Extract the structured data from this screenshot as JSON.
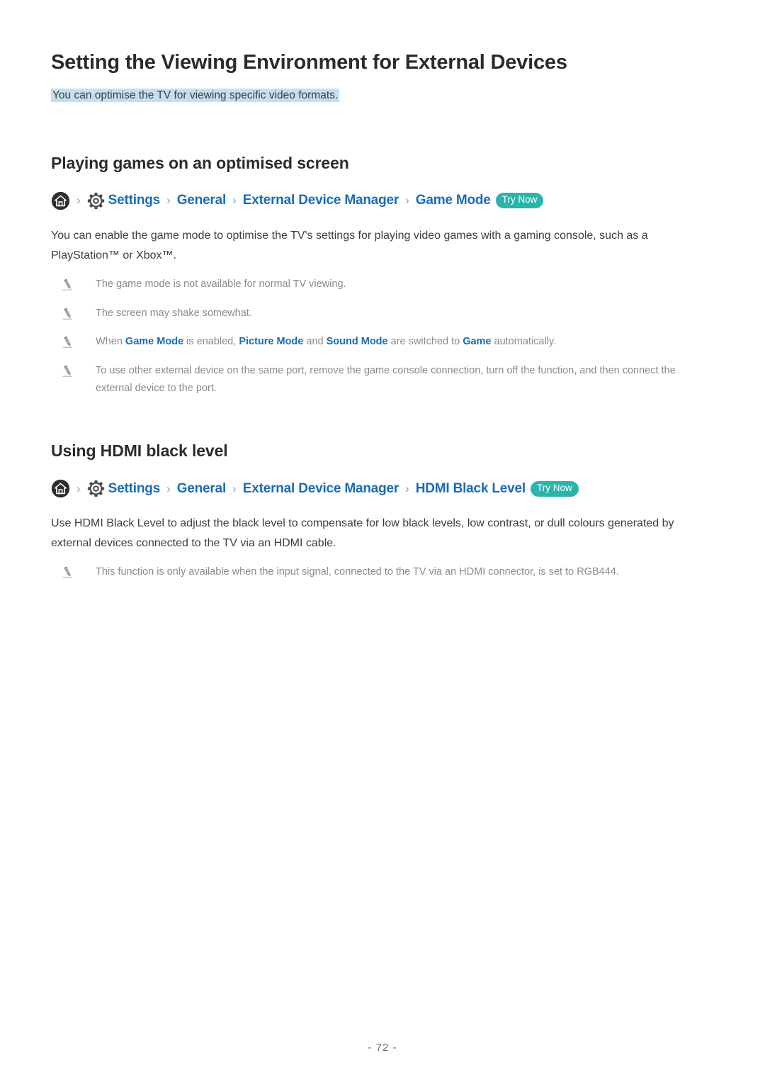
{
  "page": {
    "title": "Setting the Viewing Environment for External Devices",
    "subtitle": "You can optimise the TV for viewing specific video formats.",
    "footer": "- 72 -",
    "colors": {
      "link_blue": "#1a6cb5",
      "highlight": "#c5dff0",
      "badge_teal": "#2ab5ac",
      "note_gray": "#8a8a8a",
      "heading_dark": "#2b2b2b"
    }
  },
  "sections": [
    {
      "heading": "Playing games on an optimised screen",
      "breadcrumb": {
        "home_icon": "home-icon",
        "gear_icon": "gear-icon",
        "separator": "›",
        "items": [
          "Settings",
          "General",
          "External Device Manager",
          "Game Mode"
        ],
        "badge": "Try Now"
      },
      "body": "You can enable the game mode to optimise the TV's settings for playing video games with a gaming console, such as a PlayStation™ or Xbox™.",
      "notes": [
        {
          "icon": "pencil-icon",
          "parts": [
            {
              "text": "The game mode is not available for normal TV viewing.",
              "emphasis": false
            }
          ]
        },
        {
          "icon": "pencil-icon",
          "parts": [
            {
              "text": "The screen may shake somewhat.",
              "emphasis": false
            }
          ]
        },
        {
          "icon": "pencil-icon",
          "parts": [
            {
              "text": "When ",
              "emphasis": false
            },
            {
              "text": "Game Mode",
              "emphasis": true
            },
            {
              "text": " is enabled, ",
              "emphasis": false
            },
            {
              "text": "Picture Mode",
              "emphasis": true
            },
            {
              "text": " and ",
              "emphasis": false
            },
            {
              "text": "Sound Mode",
              "emphasis": true
            },
            {
              "text": " are switched to ",
              "emphasis": false
            },
            {
              "text": "Game",
              "emphasis": true
            },
            {
              "text": " automatically.",
              "emphasis": false
            }
          ]
        },
        {
          "icon": "pencil-icon",
          "parts": [
            {
              "text": "To use other external device on the same port, remove the game console connection, turn off the function, and then connect the external device to the port.",
              "emphasis": false
            }
          ]
        }
      ]
    },
    {
      "heading": "Using HDMI black level",
      "breadcrumb": {
        "home_icon": "home-icon",
        "gear_icon": "gear-icon",
        "separator": "›",
        "items": [
          "Settings",
          "General",
          "External Device Manager",
          "HDMI Black Level"
        ],
        "badge": "Try Now"
      },
      "body": "Use HDMI Black Level to adjust the black level to compensate for low black levels, low contrast, or dull colours generated by external devices connected to the TV via an HDMI cable.",
      "notes": [
        {
          "icon": "pencil-icon",
          "parts": [
            {
              "text": "This function is only available when the input signal, connected to the TV via an HDMI connector, is set to RGB444.",
              "emphasis": false
            }
          ]
        }
      ]
    }
  ]
}
